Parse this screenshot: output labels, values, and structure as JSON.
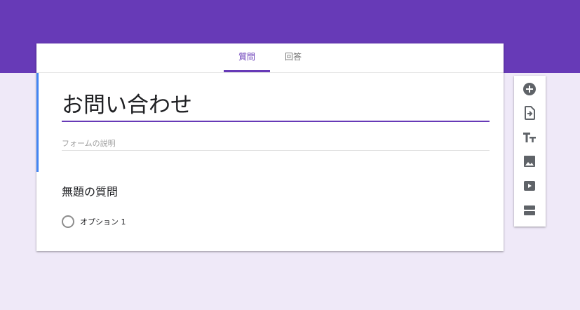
{
  "tabs": [
    {
      "label": "質問",
      "active": true
    },
    {
      "label": "回答",
      "active": false
    }
  ],
  "form": {
    "title": "お問い合わせ",
    "description_placeholder": "フォームの説明"
  },
  "question": {
    "title": "無題の質問",
    "options": [
      "オプション 1"
    ]
  },
  "toolbar": {
    "icons": [
      "add-question-icon",
      "import-questions-icon",
      "add-title-icon",
      "add-image-icon",
      "add-video-icon",
      "add-section-icon"
    ]
  },
  "colors": {
    "theme": "#673ab7",
    "background": "#efe9f8",
    "accent_blue": "#4285f4",
    "icon_gray": "#5f6368"
  }
}
